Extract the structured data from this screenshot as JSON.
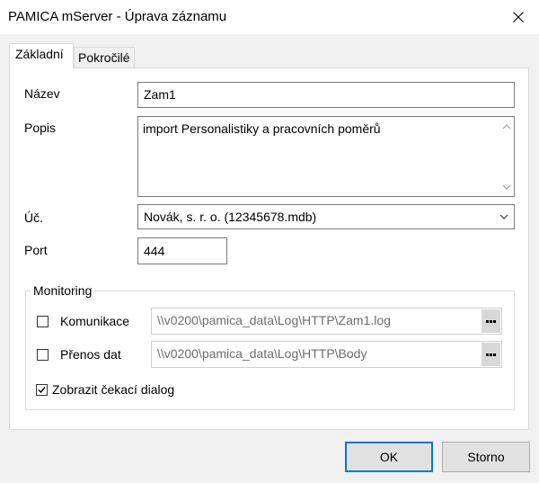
{
  "window": {
    "title": "PAMICA mServer - Úprava záznamu"
  },
  "tabs": [
    {
      "label": "Základní",
      "active": true
    },
    {
      "label": "Pokročilé",
      "active": false
    }
  ],
  "form": {
    "name_label": "Název",
    "name_value": "Zam1",
    "description_label": "Popis",
    "description_value": "import Personalistiky a pracovních poměrů",
    "account_label": "Úč.",
    "account_value": "Novák, s. r. o. (12345678.mdb)",
    "port_label": "Port",
    "port_value": "444"
  },
  "monitoring": {
    "legend": "Monitoring",
    "communication": {
      "label": "Komunikace",
      "checked": false,
      "path": "\\\\v0200\\pamica_data\\Log\\HTTP\\Zam1.log"
    },
    "data_transfer": {
      "label": "Přenos dat",
      "checked": false,
      "path": "\\\\v0200\\pamica_data\\Log\\HTTP\\Body"
    },
    "wait_dialog": {
      "label": "Zobrazit čekací dialog",
      "checked": true
    }
  },
  "buttons": {
    "ok_label": "OK",
    "cancel_label": "Storno"
  },
  "colors": {
    "accent": "#0078d7",
    "panel_bg": "#ffffff",
    "window_bg": "#f0f0f0"
  },
  "icons": {
    "close": "close-icon",
    "scroll_up": "chevron-up-icon",
    "scroll_down": "chevron-down-icon",
    "dropdown": "chevron-down-icon",
    "browse": "ellipsis-icon",
    "checkmark": "checkmark-icon"
  }
}
